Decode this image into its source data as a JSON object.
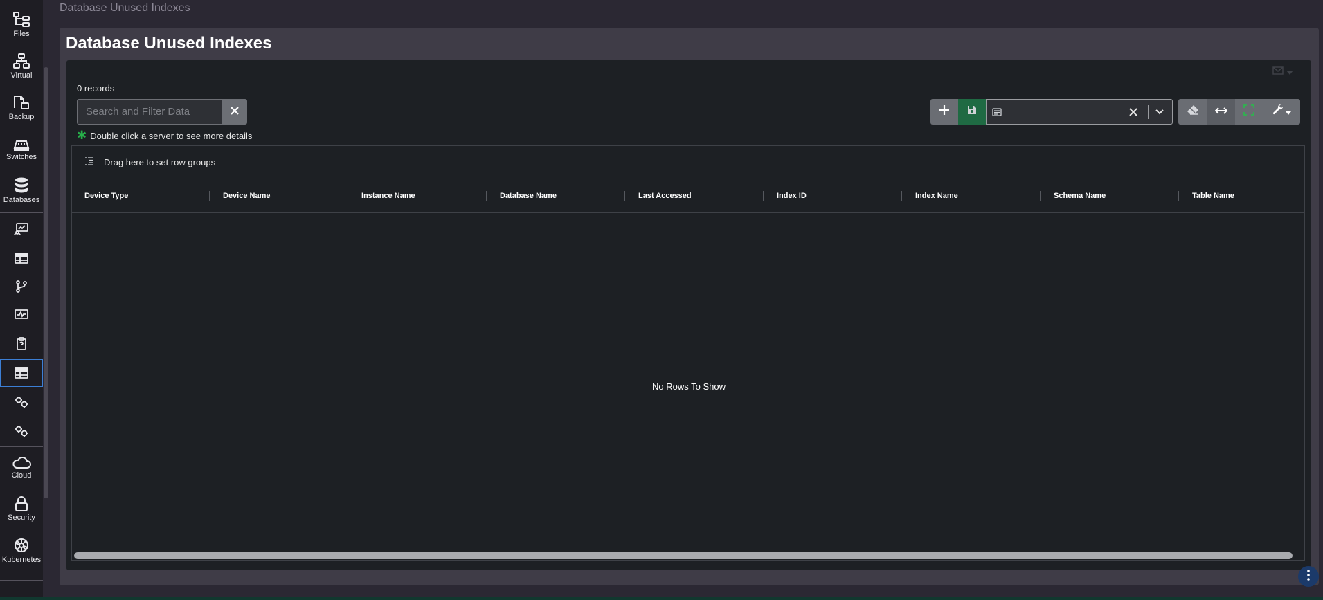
{
  "breadcrumb": "Database Unused Indexes",
  "page_title": "Database Unused Indexes",
  "sidebar": {
    "items": [
      {
        "label": "Files",
        "icon": "files-tree-icon"
      },
      {
        "label": "Virtual",
        "icon": "network-icon"
      },
      {
        "label": "Backup",
        "icon": "backup-icon"
      },
      {
        "label": "Switches",
        "icon": "switch-icon"
      },
      {
        "label": "Databases",
        "icon": "database-icon"
      },
      {
        "label": "",
        "icon": "monitor-chart-icon"
      },
      {
        "label": "",
        "icon": "table-icon"
      },
      {
        "label": "",
        "icon": "git-branch-icon"
      },
      {
        "label": "",
        "icon": "activity-monitor-icon"
      },
      {
        "label": "",
        "icon": "clipboard-icon"
      },
      {
        "label": "",
        "icon": "table-icon-active"
      },
      {
        "label": "",
        "icon": "gears-icon"
      },
      {
        "label": "",
        "icon": "gears-icon"
      },
      {
        "label": "Cloud",
        "icon": "cloud-icon"
      },
      {
        "label": "Security",
        "icon": "lock-icon"
      },
      {
        "label": "Kubernetes",
        "icon": "kubernetes-icon"
      }
    ]
  },
  "records_text": "0 records",
  "search": {
    "placeholder": "Search and Filter Data",
    "value": ""
  },
  "hint": "Double click a server to see more details",
  "view_select": {
    "value": ""
  },
  "grid": {
    "group_bar_text": "Drag here to set row groups",
    "columns": [
      "Device Type",
      "Device Name",
      "Instance Name",
      "Database Name",
      "Last Accessed",
      "Index ID",
      "Index Name",
      "Schema Name",
      "Table Name"
    ],
    "empty_text": "No Rows To Show"
  },
  "colors": {
    "accent_green": "#1f6a43",
    "active_outline": "#3c7fd6"
  }
}
